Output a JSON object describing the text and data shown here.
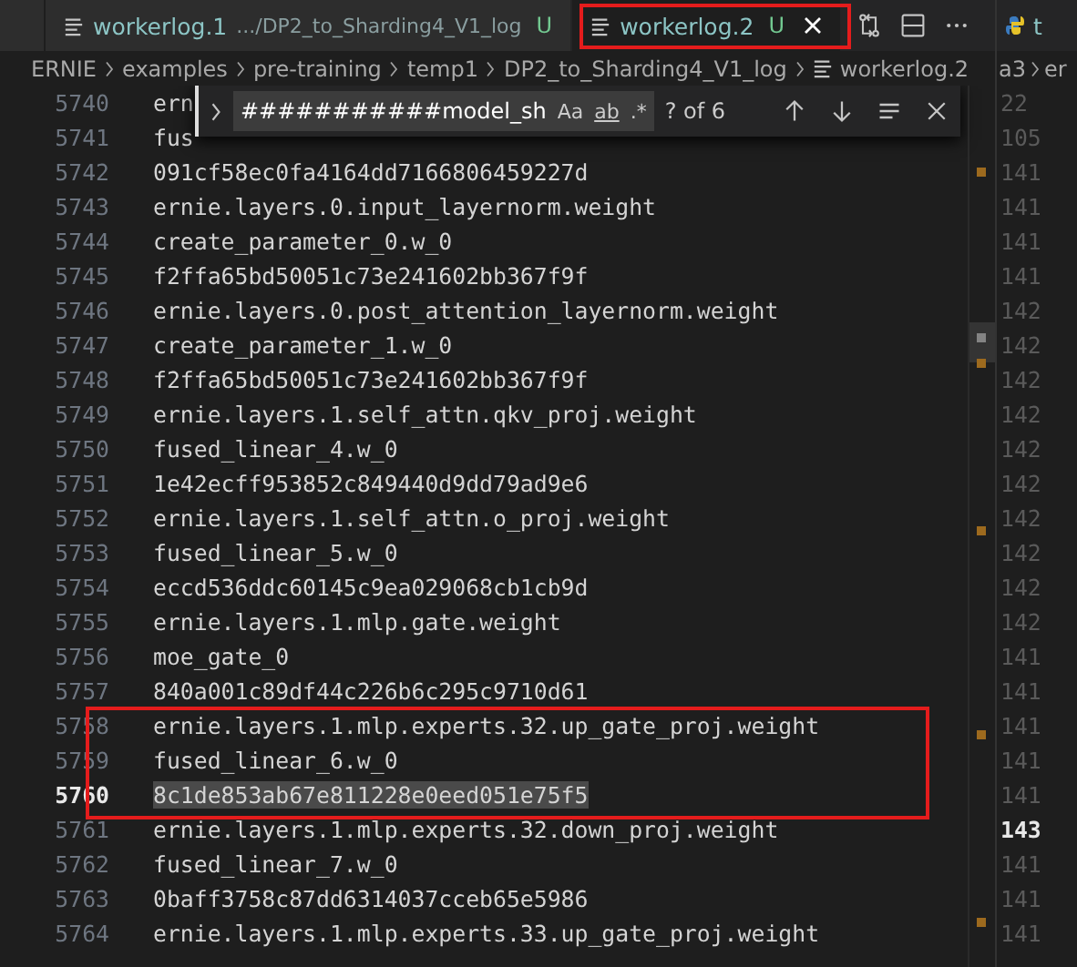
{
  "tabs": [
    {
      "label": "workerlog.1",
      "description": ".../DP2_to_Sharding4_V1_log",
      "status": "U",
      "selected": false
    },
    {
      "label": "workerlog.2",
      "status": "U",
      "selected": true
    }
  ],
  "right_group_tab": {
    "label": "t"
  },
  "breadcrumb": [
    "ERNIE",
    "examples",
    "pre-training",
    "temp1",
    "DP2_to_Sharding4_V1_log",
    "workerlog.2"
  ],
  "right_breadcrumb": [
    "a3",
    "er"
  ],
  "find_widget": {
    "value": "###########model_sh",
    "match_case": "Aa",
    "whole_word": "ab",
    "regex": ".*",
    "result": "? of 6"
  },
  "lines": [
    {
      "number": "5740",
      "text": "ern",
      "current": false
    },
    {
      "number": "5741",
      "text": "fus",
      "current": false
    },
    {
      "number": "5742",
      "text": "091cf58ec0fa4164dd7166806459227d",
      "current": false
    },
    {
      "number": "5743",
      "text": "ernie.layers.0.input_layernorm.weight",
      "current": false
    },
    {
      "number": "5744",
      "text": "create_parameter_0.w_0",
      "current": false
    },
    {
      "number": "5745",
      "text": "f2ffa65bd50051c73e241602bb367f9f",
      "current": false
    },
    {
      "number": "5746",
      "text": "ernie.layers.0.post_attention_layernorm.weight",
      "current": false
    },
    {
      "number": "5747",
      "text": "create_parameter_1.w_0",
      "current": false
    },
    {
      "number": "5748",
      "text": "f2ffa65bd50051c73e241602bb367f9f",
      "current": false
    },
    {
      "number": "5749",
      "text": "ernie.layers.1.self_attn.qkv_proj.weight",
      "current": false
    },
    {
      "number": "5750",
      "text": "fused_linear_4.w_0",
      "current": false
    },
    {
      "number": "5751",
      "text": "1e42ecff953852c849440d9dd79ad9e6",
      "current": false
    },
    {
      "number": "5752",
      "text": "ernie.layers.1.self_attn.o_proj.weight",
      "current": false
    },
    {
      "number": "5753",
      "text": "fused_linear_5.w_0",
      "current": false
    },
    {
      "number": "5754",
      "text": "eccd536ddc60145c9ea029068cb1cb9d",
      "current": false
    },
    {
      "number": "5755",
      "text": "ernie.layers.1.mlp.gate.weight",
      "current": false
    },
    {
      "number": "5756",
      "text": "moe_gate_0",
      "current": false
    },
    {
      "number": "5757",
      "text": "840a001c89df44c226b6c295c9710d61",
      "current": false
    },
    {
      "number": "5758",
      "text": "ernie.layers.1.mlp.experts.32.up_gate_proj.weight",
      "current": false
    },
    {
      "number": "5759",
      "text": "fused_linear_6.w_0",
      "current": false
    },
    {
      "number": "5760",
      "text": "8c1de853ab67e811228e0eed051e75f5",
      "current": true
    },
    {
      "number": "5761",
      "text": "ernie.layers.1.mlp.experts.32.down_proj.weight",
      "current": false
    },
    {
      "number": "5762",
      "text": "fused_linear_7.w_0",
      "current": false
    },
    {
      "number": "5763",
      "text": "0baff3758c87dd6314037cceb65e5986",
      "current": false
    },
    {
      "number": "5764",
      "text": "ernie.layers.1.mlp.experts.33.up_gate_proj.weight",
      "current": false
    }
  ],
  "right_lines": [
    {
      "number": "22",
      "current": false
    },
    {
      "number": "105",
      "current": false
    },
    {
      "number": "141",
      "current": false
    },
    {
      "number": "141",
      "current": false
    },
    {
      "number": "141",
      "current": false
    },
    {
      "number": "141",
      "current": false
    },
    {
      "number": "142",
      "current": false
    },
    {
      "number": "142",
      "current": false
    },
    {
      "number": "142",
      "current": false
    },
    {
      "number": "142",
      "current": false
    },
    {
      "number": "142",
      "current": false
    },
    {
      "number": "142",
      "current": false
    },
    {
      "number": "142",
      "current": false
    },
    {
      "number": "142",
      "current": false
    },
    {
      "number": "142",
      "current": false
    },
    {
      "number": "142",
      "current": false
    },
    {
      "number": "141",
      "current": false
    },
    {
      "number": "141",
      "current": false
    },
    {
      "number": "141",
      "current": false
    },
    {
      "number": "141",
      "current": false
    },
    {
      "number": "141",
      "current": false
    },
    {
      "number": "143",
      "current": true
    },
    {
      "number": "141",
      "current": false
    },
    {
      "number": "141",
      "current": false
    },
    {
      "number": "141",
      "current": false
    }
  ]
}
